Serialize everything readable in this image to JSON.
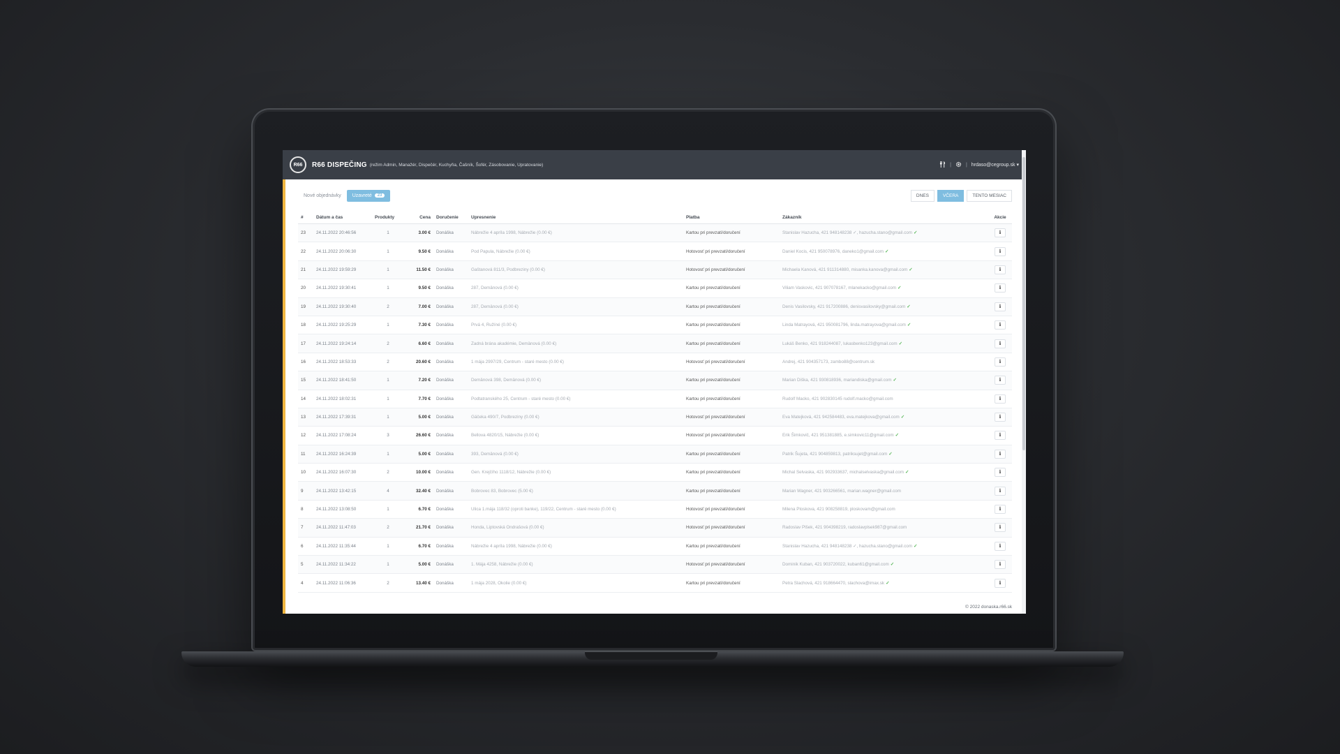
{
  "app": {
    "logo_text": "R66",
    "brand": "R66 DISPEČING",
    "brand_sub": "(režim Admin, Manažér, Dispečér, Kuchyňa, Čašník, Šofér, Zásobovanie, Upratovanie)",
    "user": "hrdaso@cegroup.sk"
  },
  "tabs": {
    "new_orders": "Nové objednávky",
    "closed": "Uzavreté",
    "closed_count": "23"
  },
  "filters": [
    "DNES",
    "VČERA",
    "TENTO MESIAC"
  ],
  "active_filter": 1,
  "table": {
    "headers": [
      "#",
      "Dátum a čas",
      "Produkty",
      "Cena",
      "Doručenie",
      "Upresnenie",
      "Platba",
      "Zákazník",
      "Akcie"
    ],
    "rows": [
      {
        "id": "23",
        "datetime": "24.11.2022 20:46:56",
        "products": "1",
        "price": "3.00 €",
        "delivery": "Donáška",
        "note": "Nábrežie 4 apríla 1998, Nábrežie (0.00 €)",
        "payment": "Kartou pri prevzatí/doručení",
        "customer": "Stanislav Hazucha, 421 948148238 ✓, hazucha.stano@gmail.com",
        "verified": true
      },
      {
        "id": "22",
        "datetime": "24.11.2022 20:06:30",
        "products": "1",
        "price": "9.50 €",
        "delivery": "Donáška",
        "note": "Pod Papula, Nábrežie (0.00 €)",
        "payment": "Hotovosť pri prevzatí/doručení",
        "customer": "Daniel Kocis, 421 950078976, daneko1@gmail.com",
        "verified": true
      },
      {
        "id": "21",
        "datetime": "24.11.2022 19:59:29",
        "products": "1",
        "price": "11.50 €",
        "delivery": "Donáška",
        "note": "Gaštanová 811/3, Podbreziny (0.00 €)",
        "payment": "Hotovosť pri prevzatí/doručení",
        "customer": "Michaela Kanová, 421 911314880, misanka.kanova@gmail.com",
        "verified": true
      },
      {
        "id": "20",
        "datetime": "24.11.2022 19:30:41",
        "products": "1",
        "price": "9.50 €",
        "delivery": "Donáška",
        "note": "287, Demänová (0.00 €)",
        "payment": "Kartou pri prevzatí/doručení",
        "customer": "Viliam Vaskovic, 421 907078167, mlanekacko@gmail.com",
        "verified": true
      },
      {
        "id": "19",
        "datetime": "24.11.2022 19:30:40",
        "products": "2",
        "price": "7.00 €",
        "delivery": "Donáška",
        "note": "287, Demänová (0.00 €)",
        "payment": "Kartou pri prevzatí/doručení",
        "customer": "Denis Vasilovsky, 421 917200886, denisvasilovsky@gmail.com",
        "verified": true
      },
      {
        "id": "18",
        "datetime": "24.11.2022 19:25:29",
        "products": "1",
        "price": "7.30 €",
        "delivery": "Donáška",
        "note": "Prvá 4, Ružíné (0.00 €)",
        "payment": "Kartou pri prevzatí/doručení",
        "customer": "Linda Matrayová, 421 950081796, linda.matrayova@gmail.com",
        "verified": true
      },
      {
        "id": "17",
        "datetime": "24.11.2022 19:24:14",
        "products": "2",
        "price": "6.60 €",
        "delivery": "Donáška",
        "note": "Zadná brána akadémie, Demänová (0.00 €)",
        "payment": "Kartou pri prevzatí/doručení",
        "customer": "Lukáš Benko, 421 918244087, lukasbenko123@gmail.com",
        "verified": true
      },
      {
        "id": "16",
        "datetime": "24.11.2022 18:53:33",
        "products": "2",
        "price": "20.60 €",
        "delivery": "Donáška",
        "note": "1 mája 2997/29, Centrum - staré mesto (0.00 €)",
        "payment": "Hotovosť pri prevzatí/doručení",
        "customer": "Andrej, 421 904357173, zambo88@centrum.sk",
        "verified": false
      },
      {
        "id": "15",
        "datetime": "24.11.2022 18:41:50",
        "products": "1",
        "price": "7.20 €",
        "delivery": "Donáška",
        "note": "Demänová 398, Demänová (0.00 €)",
        "payment": "Kartou pri prevzatí/doručení",
        "customer": "Marian Diška, 421 930818936, mariandiska@gmail.com",
        "verified": true
      },
      {
        "id": "14",
        "datetime": "24.11.2022 18:02:31",
        "products": "1",
        "price": "7.70 €",
        "delivery": "Donáška",
        "note": "Podtatranského 25, Centrum - staré mesto (0.00 €)",
        "payment": "Kartou pri prevzatí/doručení",
        "customer": "Rudolf Macko, 421 902830145 rudolf.macko@gmail.com",
        "verified": false
      },
      {
        "id": "13",
        "datetime": "24.11.2022 17:39:31",
        "products": "1",
        "price": "5.00 €",
        "delivery": "Donáška",
        "note": "Gäčeka 490/7, Podbreziny (0.00 €)",
        "payment": "Hotovosť pri prevzatí/doručení",
        "customer": "Eva Matejková, 421 942584483, eva.matejkova@gmail.com",
        "verified": true
      },
      {
        "id": "12",
        "datetime": "24.11.2022 17:08:24",
        "products": "3",
        "price": "26.60 €",
        "delivery": "Donáška",
        "note": "Bellova 4820/15, Nábrežie (0.00 €)",
        "payment": "Hotovosť pri prevzatí/doručení",
        "customer": "Erik Šimkovič, 421 951381885, e.simkovic11@gmail.com",
        "verified": true
      },
      {
        "id": "11",
        "datetime": "24.11.2022 16:24:39",
        "products": "1",
        "price": "5.00 €",
        "delivery": "Donáška",
        "note": "393, Demänová (0.00 €)",
        "payment": "Kartou pri prevzatí/doručení",
        "customer": "Patrik Šujeta, 421 904859813, patriksujet@gmail.com",
        "verified": true
      },
      {
        "id": "10",
        "datetime": "24.11.2022 16:07:30",
        "products": "2",
        "price": "10.00 €",
        "delivery": "Donáška",
        "note": "Gen. Krejčího 1118/12, Nábrežie (0.00 €)",
        "payment": "Kartou pri prevzatí/doručení",
        "customer": "Michal Selvaska, 421 902933637, michalselvaska@gmail.com",
        "verified": true
      },
      {
        "id": "9",
        "datetime": "24.11.2022 13:42:15",
        "products": "4",
        "price": "32.40 €",
        "delivery": "Donáška",
        "note": "Bobrovec 83, Bobrovec (5.00 €)",
        "payment": "Kartou pri prevzatí/doručení",
        "customer": "Marian Wagner, 421 903266561, marian.wagner@gmail.com",
        "verified": false
      },
      {
        "id": "8",
        "datetime": "24.11.2022 13:08:50",
        "products": "1",
        "price": "6.70 €",
        "delivery": "Donáška",
        "note": "Ulica 1.mája 118/32 (oproti banke), 119/22, Centrum - staré mesto (0.00 €)",
        "payment": "Hotovosť pri prevzatí/doručení",
        "customer": "Milena Ploskova, 421 908258819, ploskovam@gmail.com",
        "verified": false
      },
      {
        "id": "7",
        "datetime": "24.11.2022 11:47:03",
        "products": "2",
        "price": "21.70 €",
        "delivery": "Donáška",
        "note": "Honda, Liptovská Ondrašová (0.00 €)",
        "payment": "Hotovosť pri prevzatí/doručení",
        "customer": "Radoslav Plšek, 421 904398219, radoslavplsek987@gmail.com",
        "verified": false
      },
      {
        "id": "6",
        "datetime": "24.11.2022 11:35:44",
        "products": "1",
        "price": "6.70 €",
        "delivery": "Donáška",
        "note": "Nábrežie 4 apríla 1998, Nábrežie (0.00 €)",
        "payment": "Kartou pri prevzatí/doručení",
        "customer": "Stanislav Hazucha, 421 948148238 ✓, hazucha.stano@gmail.com",
        "verified": true
      },
      {
        "id": "5",
        "datetime": "24.11.2022 11:34:22",
        "products": "1",
        "price": "5.00 €",
        "delivery": "Donáška",
        "note": "1. Mája 4258, Nábrežie (0.00 €)",
        "payment": "Hotovosť pri prevzatí/doručení",
        "customer": "Dominik Kuban, 421 903720022, kuban61@gmail.com",
        "verified": true
      },
      {
        "id": "4",
        "datetime": "24.11.2022 11:06:36",
        "products": "2",
        "price": "13.40 €",
        "delivery": "Donáška",
        "note": "1 mája 2028, Okolie (0.00 €)",
        "payment": "Kartou pri prevzatí/doručení",
        "customer": "Petra Slachová, 421 918664470, slachova@imax.sk",
        "verified": true
      }
    ]
  },
  "footer": "© 2022 donaska.r66.sk",
  "colors": {
    "accent": "#7fbde0",
    "topbar": "#3a3f47",
    "side_strip": "#f0b640",
    "verified": "#5cb85c"
  }
}
